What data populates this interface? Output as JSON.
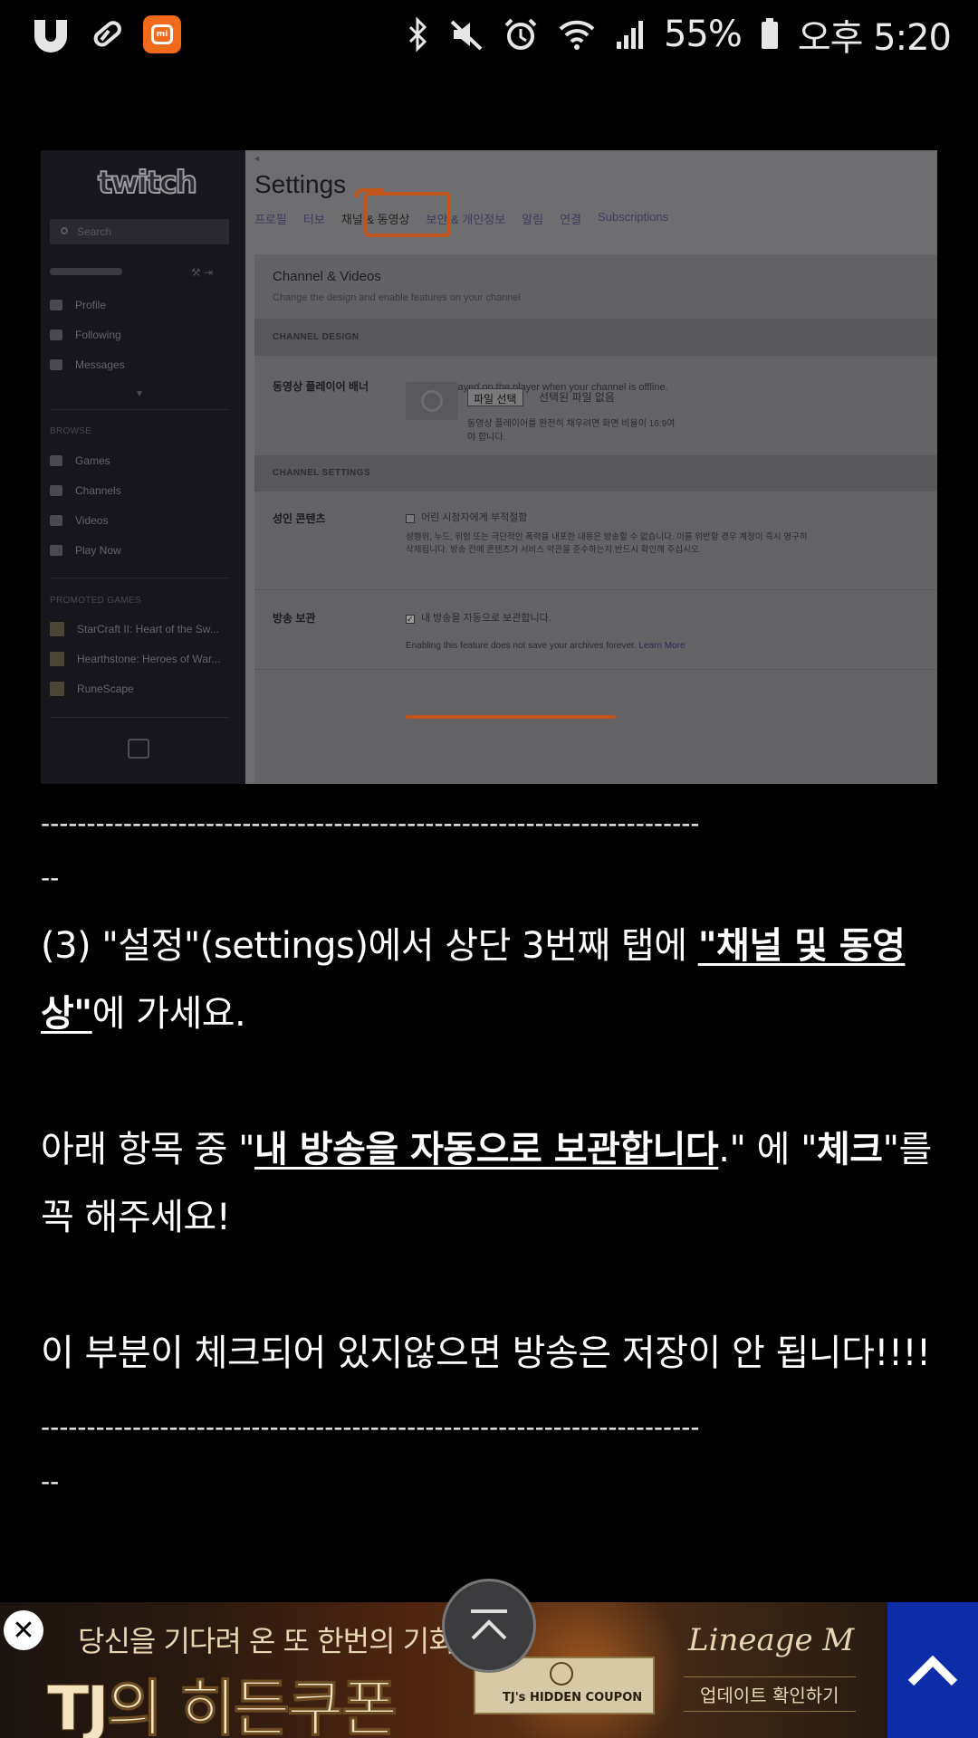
{
  "status_bar": {
    "battery": "55%",
    "time": "오후 5:20",
    "mi_label": "mi",
    "icons": [
      "u-app-icon",
      "pill-icon",
      "mi-app-icon",
      "bluetooth-icon",
      "mute-icon",
      "alarm-icon",
      "wifi-icon",
      "signal-icon",
      "battery-icon"
    ]
  },
  "screenshot": {
    "sidebar": {
      "logo": "twitch",
      "search_placeholder": "Search",
      "items": [
        "Profile",
        "Following",
        "Messages"
      ],
      "browse_header": "BROWSE",
      "browse_items": [
        "Games",
        "Channels",
        "Videos",
        "Play Now"
      ],
      "promoted_header": "PROMOTED GAMES",
      "promoted_games": [
        "StarCraft II: Heart of the Sw...",
        "Hearthstone: Heroes of War...",
        "RuneScape"
      ]
    },
    "settings": {
      "title": "Settings",
      "tabs": [
        "프로필",
        "터보",
        "채널 & 동영상",
        "보안 & 개인정보",
        "알림",
        "연결",
        "Subscriptions"
      ],
      "panel_title": "Channel & Videos",
      "panel_subtitle": "Change the design and enable features on your channel",
      "channel_design_header": "CHANNEL DESIGN",
      "banner_label": "동영상 플레이어 배너",
      "banner_desc": "This is displayed on the player when your channel is offline.",
      "file_button": "파일 선택",
      "file_status": "선택된 파일 없음",
      "file_hint": "동영상 플레이어를 완전히 채우려면 화면 비율이 16:9여야 합니다.",
      "channel_settings_header": "CHANNEL SETTINGS",
      "mature_label": "성인 콘텐츠",
      "mature_option": "어린 시청자에게 부적절함",
      "mature_desc": "성행위, 누드, 위험 또는 극단적인 폭력을 내포한 내용은 방송할 수 없습니다. 이를 위반할 경우 계정이 즉시 영구히 삭제됩니다. 방송 전에 콘텐츠가 서비스 약관을 준수하는지 반드시 확인해 주십시오.",
      "archive_label": "방송 보관",
      "archive_option": "내 방송을 자동으로 보관합니다.",
      "archive_checked": true,
      "archive_note": "Enabling this feature does not save your archives forever.",
      "learn_more": "Learn More"
    },
    "annotation_color": "#c1541a"
  },
  "article": {
    "dashes": "------------------------------------------------------------------------",
    "dashes_tail": "--",
    "step_prefix": "(3) \"설정\"(settings)에서 상단 3번째 탭에 ",
    "step_link": "\"채널 및 동영상\"",
    "step_suffix": "에 가세요.",
    "check_prefix": "아래 항목 중 \"",
    "check_link": "내 방송을 자동으로 보관합니다",
    "check_mid": ".\" 에 \"",
    "check_bold": "체크",
    "check_suffix": "\"를 꼭 해주세요!",
    "warning": "이 부분이 체크되어 있지않으면 방송은 저장이 안 됩니다!!!!"
  },
  "ad": {
    "subtitle": "당신을 기다려 온 또 한번의 기회",
    "title": "TJ의 히든쿠폰",
    "coupon_text": "TJ's HIDDEN COUPON",
    "brand": "Lineage M",
    "cta": "업데이트 확인하기"
  }
}
